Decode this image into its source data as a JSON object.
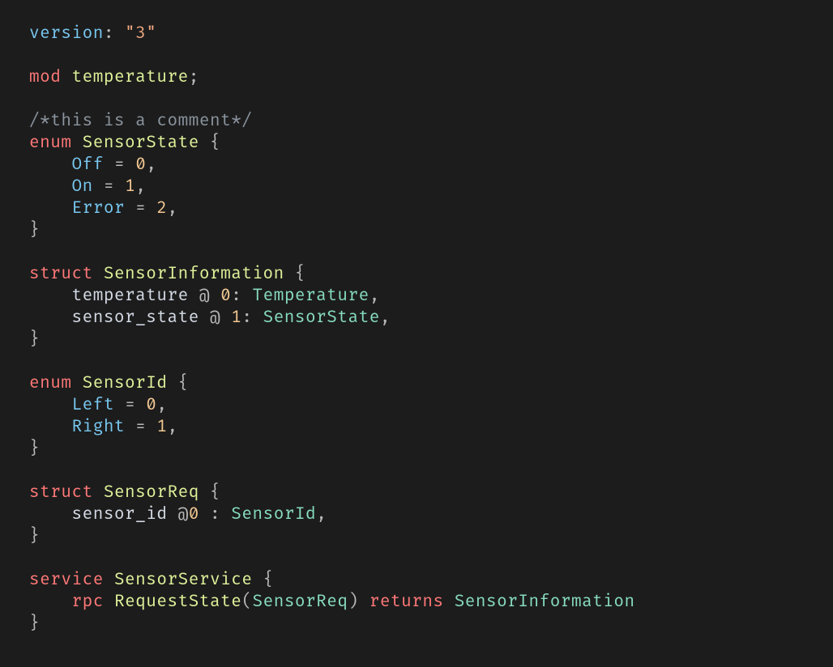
{
  "code": {
    "tokens": [
      {
        "cls": "member",
        "text": "version"
      },
      {
        "cls": "pun",
        "text": ": "
      },
      {
        "cls": "str",
        "text": "\"3\""
      },
      {
        "cls": "",
        "text": "\n"
      },
      {
        "cls": "",
        "text": "\n"
      },
      {
        "cls": "kw",
        "text": "mod"
      },
      {
        "cls": "",
        "text": " "
      },
      {
        "cls": "def",
        "text": "temperature"
      },
      {
        "cls": "pun",
        "text": ";"
      },
      {
        "cls": "",
        "text": "\n"
      },
      {
        "cls": "",
        "text": "\n"
      },
      {
        "cls": "cmt",
        "text": "/*this is a comment*/"
      },
      {
        "cls": "",
        "text": "\n"
      },
      {
        "cls": "kw",
        "text": "enum"
      },
      {
        "cls": "",
        "text": " "
      },
      {
        "cls": "def",
        "text": "SensorState"
      },
      {
        "cls": "",
        "text": " "
      },
      {
        "cls": "pun",
        "text": "{"
      },
      {
        "cls": "",
        "text": "\n"
      },
      {
        "cls": "",
        "text": "    "
      },
      {
        "cls": "member",
        "text": "Off"
      },
      {
        "cls": "",
        "text": " "
      },
      {
        "cls": "pun",
        "text": "= "
      },
      {
        "cls": "num",
        "text": "0"
      },
      {
        "cls": "pun",
        "text": ","
      },
      {
        "cls": "",
        "text": "\n"
      },
      {
        "cls": "",
        "text": "    "
      },
      {
        "cls": "member",
        "text": "On"
      },
      {
        "cls": "",
        "text": " "
      },
      {
        "cls": "pun",
        "text": "= "
      },
      {
        "cls": "num",
        "text": "1"
      },
      {
        "cls": "pun",
        "text": ","
      },
      {
        "cls": "",
        "text": "\n"
      },
      {
        "cls": "",
        "text": "    "
      },
      {
        "cls": "member",
        "text": "Error"
      },
      {
        "cls": "",
        "text": " "
      },
      {
        "cls": "pun",
        "text": "= "
      },
      {
        "cls": "num",
        "text": "2"
      },
      {
        "cls": "pun",
        "text": ","
      },
      {
        "cls": "",
        "text": "\n"
      },
      {
        "cls": "pun",
        "text": "}"
      },
      {
        "cls": "",
        "text": "\n"
      },
      {
        "cls": "",
        "text": "\n"
      },
      {
        "cls": "kw",
        "text": "struct"
      },
      {
        "cls": "",
        "text": " "
      },
      {
        "cls": "def",
        "text": "SensorInformation"
      },
      {
        "cls": "",
        "text": " "
      },
      {
        "cls": "pun",
        "text": "{"
      },
      {
        "cls": "",
        "text": "\n"
      },
      {
        "cls": "",
        "text": "    "
      },
      {
        "cls": "prop",
        "text": "temperature"
      },
      {
        "cls": "",
        "text": " "
      },
      {
        "cls": "pun",
        "text": "@ "
      },
      {
        "cls": "num",
        "text": "0"
      },
      {
        "cls": "pun",
        "text": ": "
      },
      {
        "cls": "type",
        "text": "Temperature"
      },
      {
        "cls": "pun",
        "text": ","
      },
      {
        "cls": "",
        "text": "\n"
      },
      {
        "cls": "",
        "text": "    "
      },
      {
        "cls": "prop",
        "text": "sensor_state"
      },
      {
        "cls": "",
        "text": " "
      },
      {
        "cls": "pun",
        "text": "@ "
      },
      {
        "cls": "num",
        "text": "1"
      },
      {
        "cls": "pun",
        "text": ": "
      },
      {
        "cls": "type",
        "text": "SensorState"
      },
      {
        "cls": "pun",
        "text": ","
      },
      {
        "cls": "",
        "text": "\n"
      },
      {
        "cls": "pun",
        "text": "}"
      },
      {
        "cls": "",
        "text": "\n"
      },
      {
        "cls": "",
        "text": "\n"
      },
      {
        "cls": "kw",
        "text": "enum"
      },
      {
        "cls": "",
        "text": " "
      },
      {
        "cls": "def",
        "text": "SensorId"
      },
      {
        "cls": "",
        "text": " "
      },
      {
        "cls": "pun",
        "text": "{"
      },
      {
        "cls": "",
        "text": "\n"
      },
      {
        "cls": "",
        "text": "    "
      },
      {
        "cls": "member",
        "text": "Left"
      },
      {
        "cls": "",
        "text": " "
      },
      {
        "cls": "pun",
        "text": "= "
      },
      {
        "cls": "num",
        "text": "0"
      },
      {
        "cls": "pun",
        "text": ","
      },
      {
        "cls": "",
        "text": "\n"
      },
      {
        "cls": "",
        "text": "    "
      },
      {
        "cls": "member",
        "text": "Right"
      },
      {
        "cls": "",
        "text": " "
      },
      {
        "cls": "pun",
        "text": "= "
      },
      {
        "cls": "num",
        "text": "1"
      },
      {
        "cls": "pun",
        "text": ","
      },
      {
        "cls": "",
        "text": "\n"
      },
      {
        "cls": "pun",
        "text": "}"
      },
      {
        "cls": "",
        "text": "\n"
      },
      {
        "cls": "",
        "text": "\n"
      },
      {
        "cls": "kw",
        "text": "struct"
      },
      {
        "cls": "",
        "text": " "
      },
      {
        "cls": "def",
        "text": "SensorReq"
      },
      {
        "cls": "",
        "text": " "
      },
      {
        "cls": "pun",
        "text": "{"
      },
      {
        "cls": "",
        "text": "\n"
      },
      {
        "cls": "",
        "text": "    "
      },
      {
        "cls": "prop",
        "text": "sensor_id"
      },
      {
        "cls": "",
        "text": " "
      },
      {
        "cls": "pun",
        "text": "@"
      },
      {
        "cls": "num",
        "text": "0"
      },
      {
        "cls": "pun",
        "text": " : "
      },
      {
        "cls": "type",
        "text": "SensorId"
      },
      {
        "cls": "pun",
        "text": ","
      },
      {
        "cls": "",
        "text": "\n"
      },
      {
        "cls": "pun",
        "text": "}"
      },
      {
        "cls": "",
        "text": "\n"
      },
      {
        "cls": "",
        "text": "\n"
      },
      {
        "cls": "kw",
        "text": "service"
      },
      {
        "cls": "",
        "text": " "
      },
      {
        "cls": "def",
        "text": "SensorService"
      },
      {
        "cls": "",
        "text": " "
      },
      {
        "cls": "pun",
        "text": "{"
      },
      {
        "cls": "",
        "text": "\n"
      },
      {
        "cls": "",
        "text": "    "
      },
      {
        "cls": "kw",
        "text": "rpc"
      },
      {
        "cls": "",
        "text": " "
      },
      {
        "cls": "def",
        "text": "RequestState"
      },
      {
        "cls": "pun",
        "text": "("
      },
      {
        "cls": "type",
        "text": "SensorReq"
      },
      {
        "cls": "pun",
        "text": ") "
      },
      {
        "cls": "kw",
        "text": "returns"
      },
      {
        "cls": "",
        "text": " "
      },
      {
        "cls": "type",
        "text": "SensorInformation"
      },
      {
        "cls": "",
        "text": "\n"
      },
      {
        "cls": "pun",
        "text": "}"
      }
    ]
  }
}
